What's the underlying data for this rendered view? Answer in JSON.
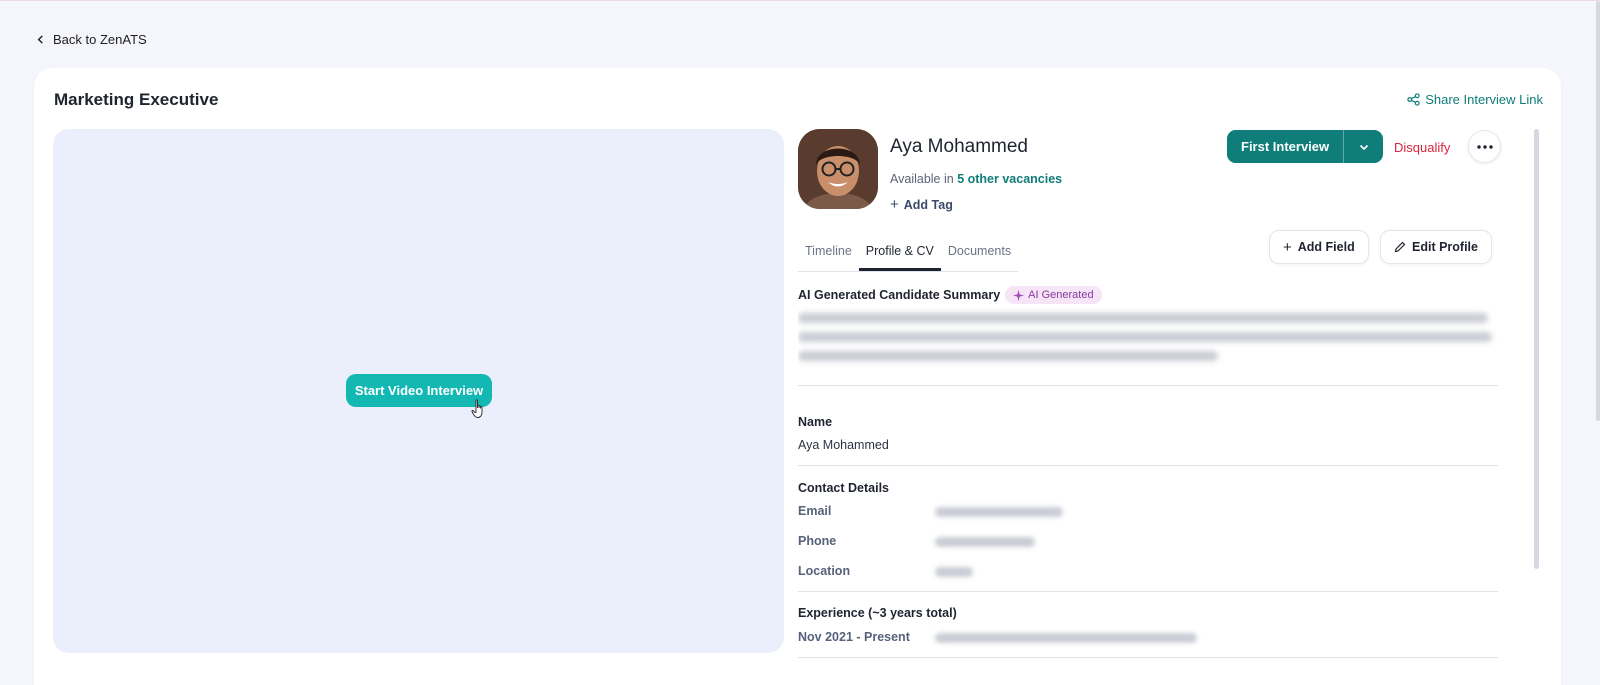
{
  "nav": {
    "back_label": "Back to ZenATS"
  },
  "page": {
    "title": "Marketing Executive",
    "share_label": "Share Interview Link"
  },
  "video": {
    "start_label": "Start Video Interview"
  },
  "candidate": {
    "name": "Aya Mohammed",
    "available_prefix": "Available in ",
    "available_link": "5 other vacancies",
    "add_tag_label": "Add Tag"
  },
  "actions": {
    "stage_label": "First Interview",
    "disqualify_label": "Disqualify"
  },
  "tabs": [
    {
      "label": "Timeline",
      "active": false
    },
    {
      "label": "Profile & CV",
      "active": true
    },
    {
      "label": "Documents",
      "active": false
    }
  ],
  "profile_actions": {
    "add_field_label": "Add Field",
    "edit_profile_label": "Edit Profile"
  },
  "summary": {
    "title": "AI Generated Candidate Summary",
    "badge": "AI Generated"
  },
  "fields": {
    "name_label": "Name",
    "name_value": "Aya Mohammed",
    "contact_title": "Contact Details",
    "email_label": "Email",
    "phone_label": "Phone",
    "location_label": "Location",
    "experience_title": "Experience (~3 years total)",
    "experience_period": "Nov 2021 - Present"
  },
  "colors": {
    "primary": "#0f7d7a",
    "cta": "#13b8b3",
    "danger": "#d7263d",
    "ai_badge": "#8a3aa0"
  }
}
